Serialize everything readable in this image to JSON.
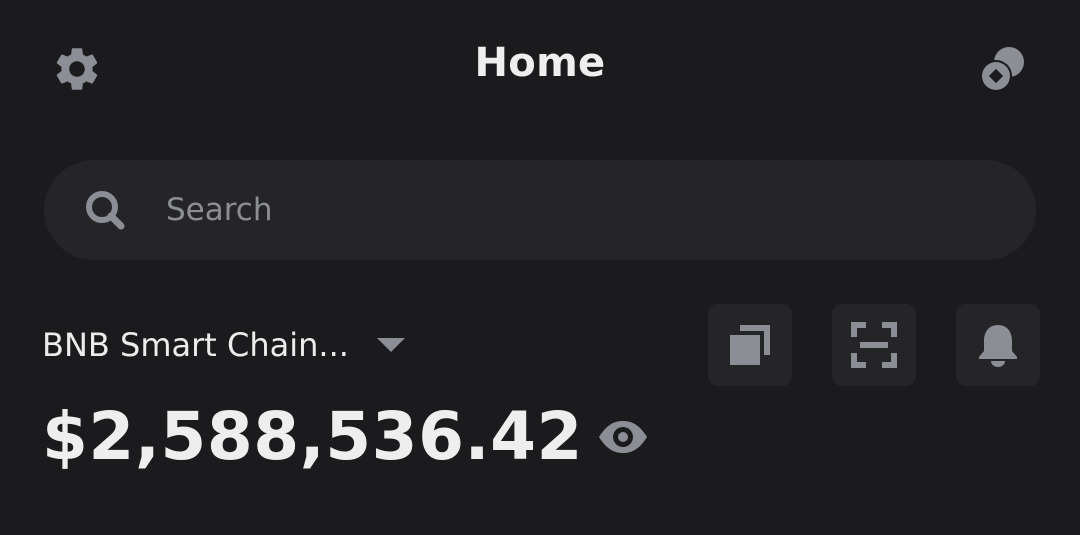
{
  "header": {
    "title": "Home",
    "settings_icon": "gear-icon",
    "assets_icon": "coins-icon"
  },
  "search": {
    "placeholder": "Search",
    "value": "",
    "icon": "search-icon"
  },
  "wallet": {
    "network_label": "BNB Smart Chain...",
    "balance": "$2,588,536.42",
    "actions": [
      {
        "name": "copy-address",
        "icon": "copy-icon"
      },
      {
        "name": "scan",
        "icon": "scan-icon"
      },
      {
        "name": "notifications",
        "icon": "bell-icon"
      }
    ],
    "visibility_icon": "eye-icon"
  },
  "colors": {
    "background": "#1b1b1d",
    "surface": "#252528",
    "text_primary": "#eeeeee",
    "icon_gray": "#8c8e96"
  }
}
